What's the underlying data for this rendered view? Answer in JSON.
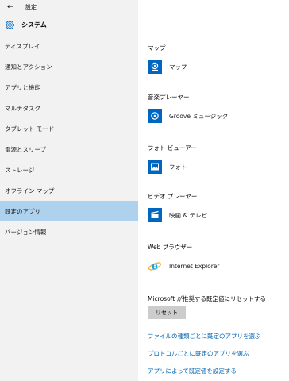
{
  "window": {
    "back_glyph": "←",
    "title": "設定"
  },
  "header": {
    "icon": "gear-icon",
    "title": "システム"
  },
  "sidebar": {
    "items": [
      {
        "label": "ディスプレイ"
      },
      {
        "label": "通知とアクション"
      },
      {
        "label": "アプリと機能"
      },
      {
        "label": "マルチタスク"
      },
      {
        "label": "タブレット モード"
      },
      {
        "label": "電源とスリープ"
      },
      {
        "label": "ストレージ"
      },
      {
        "label": "オフライン マップ"
      },
      {
        "label": "既定のアプリ",
        "active": true
      },
      {
        "label": "バージョン情報"
      }
    ]
  },
  "defaults": [
    {
      "category": "マップ",
      "app": "マップ",
      "icon": "maps-icon"
    },
    {
      "category": "音楽プレーヤー",
      "app": "Groove ミュージック",
      "icon": "groove-music-icon"
    },
    {
      "category": "フォト ビューアー",
      "app": "フォト",
      "icon": "photos-icon"
    },
    {
      "category": "ビデオ プレーヤー",
      "app": "映画 & テレビ",
      "icon": "movies-tv-icon"
    },
    {
      "category": "Web ブラウザー",
      "app": "Internet Explorer",
      "icon": "internet-explorer-icon"
    }
  ],
  "reset": {
    "label": "Microsoft が推奨する既定値にリセットする",
    "button": "リセット"
  },
  "links": [
    "ファイルの種類ごとに既定のアプリを選ぶ",
    "プロトコルごとに既定のアプリを選ぶ",
    "アプリによって既定値を設定する"
  ],
  "colors": {
    "sidebar_bg": "#f2f2f2",
    "active_item": "#aed1ee",
    "app_tile": "#0067c0",
    "link": "#0063b1",
    "button": "#cccccc"
  }
}
